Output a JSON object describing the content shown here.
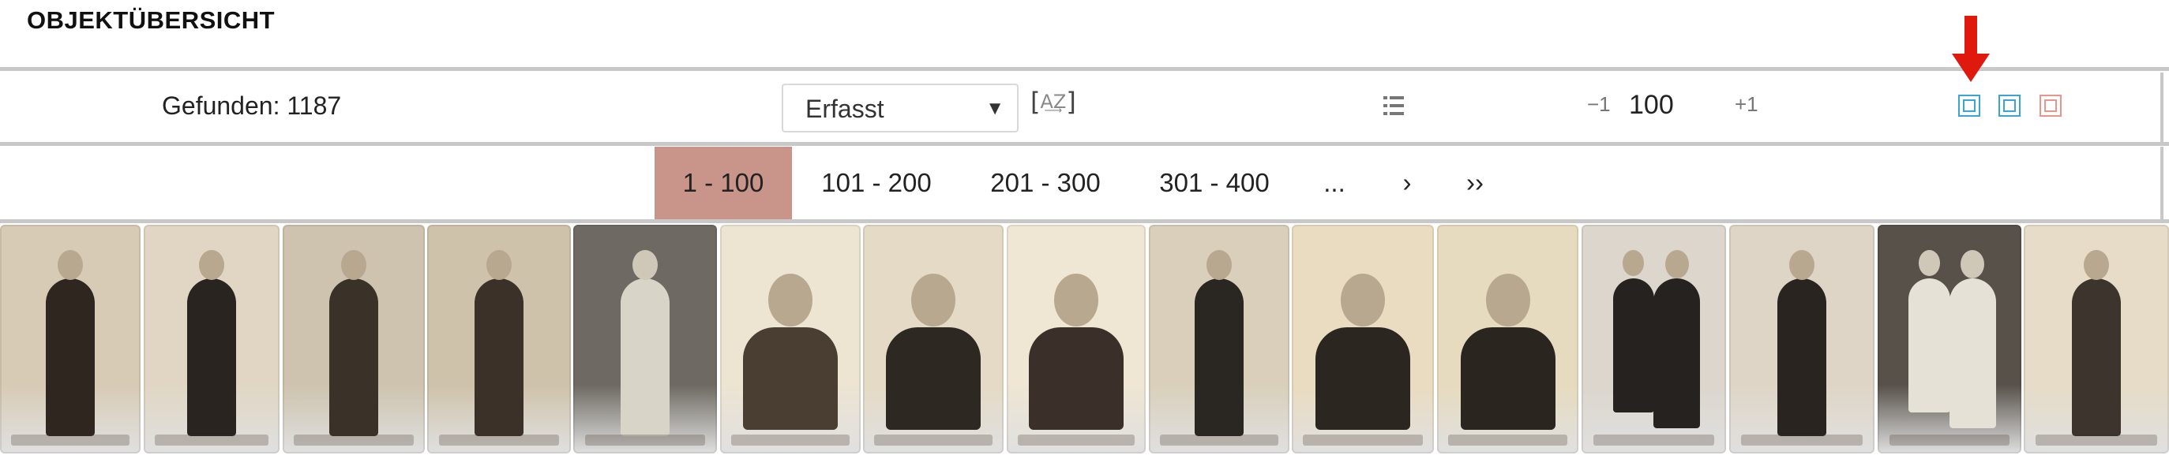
{
  "header": {
    "title": "OBJEKTÜBERSICHT"
  },
  "toolbar": {
    "found_text": "Gefunden: 1187",
    "sort_select_value": "Erfasst",
    "sort_button_label": "[A Z]",
    "page_size_minus": "−1",
    "page_size": "100",
    "page_size_plus": "+1"
  },
  "colors": {
    "accent_active_page": "#c9958a",
    "grid_icon_1": "#3aa4d6",
    "grid_icon_2": "#3aa4d6",
    "grid_icon_3": "#e8968c",
    "arrow": "#e0190f"
  },
  "pagination": {
    "items": [
      "1 - 100",
      "101 - 200",
      "201 - 300",
      "301 - 400",
      "...",
      "›",
      "››"
    ],
    "active_index": 0
  },
  "gallery": {
    "thumbs": [
      {
        "bg": "#d8cbb6",
        "fig": "#2f2620",
        "kind": "standing"
      },
      {
        "bg": "#e0d6c3",
        "fig": "#2a2420",
        "kind": "standing"
      },
      {
        "bg": "#cdc3ae",
        "fig": "#3a3229",
        "kind": "standing"
      },
      {
        "bg": "#cfc2aa",
        "fig": "#3b3128",
        "kind": "standing"
      },
      {
        "bg": "#6e6a63",
        "fig": "#d9d4c8",
        "kind": "standing"
      },
      {
        "bg": "#ede4d2",
        "fig": "#4a3e33",
        "kind": "portrait"
      },
      {
        "bg": "#e5dac5",
        "fig": "#2e2822",
        "kind": "portrait"
      },
      {
        "bg": "#efe6d3",
        "fig": "#3a3029",
        "kind": "portrait"
      },
      {
        "bg": "#d9cfbb",
        "fig": "#2a2622",
        "kind": "standing"
      },
      {
        "bg": "#eadcc0",
        "fig": "#2c2620",
        "kind": "portrait"
      },
      {
        "bg": "#e6dbbe",
        "fig": "#2b2520",
        "kind": "portrait"
      },
      {
        "bg": "#dcd6cc",
        "fig": "#262220",
        "kind": "couple"
      },
      {
        "bg": "#dfd5c6",
        "fig": "#2a2420",
        "kind": "standing"
      },
      {
        "bg": "#57514a",
        "fig": "#e6e1d6",
        "kind": "couple"
      },
      {
        "bg": "#e6dcc7",
        "fig": "#3d352d",
        "kind": "standing"
      }
    ]
  }
}
